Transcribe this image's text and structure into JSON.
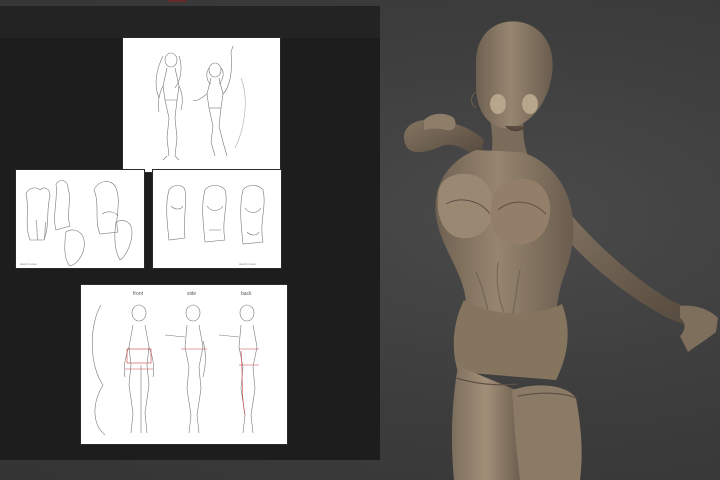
{
  "reference_panel": {
    "images": [
      {
        "name": "full-body-pose-sketch",
        "caption": ""
      },
      {
        "name": "torso-back-sketches",
        "caption": "sketch notes"
      },
      {
        "name": "torso-front-sketches",
        "caption": "sketch notes"
      },
      {
        "name": "proportion-sheet",
        "labels": [
          "front",
          "side",
          "back"
        ]
      }
    ]
  },
  "viewport": {
    "subject": "sculpted-anime-figure",
    "colors": {
      "background": "#3d3d3d",
      "clay": "#8c7b68",
      "clay_shadow": "#5d5044",
      "panel": "#1d1d1d"
    }
  }
}
